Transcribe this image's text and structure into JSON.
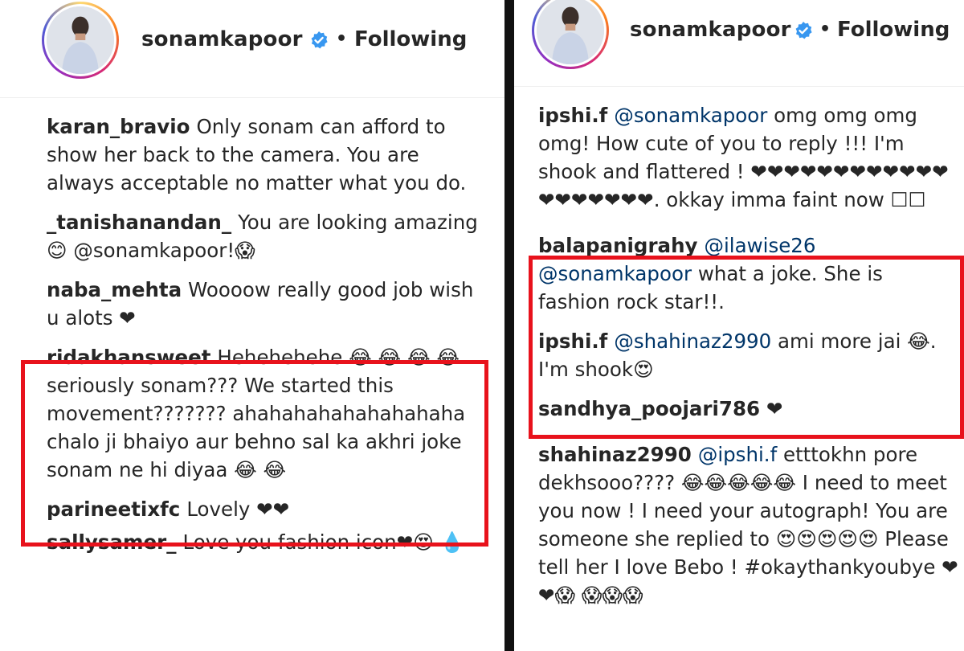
{
  "left": {
    "header": {
      "username": "sonamkapoor",
      "separator": "•",
      "follow_status": "Following"
    },
    "comments": [
      {
        "user": "karan_bravio",
        "mention": "",
        "text": "Only sonam can afford to show her back to the camera. You are always acceptable no matter what you do."
      },
      {
        "user": "_tanishanandan_",
        "mention": "",
        "text": "You are looking amazing😊 @sonamkapoor!😱"
      },
      {
        "user": "naba_mehta",
        "mention": "",
        "text": "Woooow really good job wish u alots ❤"
      },
      {
        "user": "ridakhansweet",
        "mention": "",
        "text": "Hehehehehe 😂 😂 😂 😂 seriously sonam??? We started this movement??????? ahahahahahahahahaha chalo ji bhaiyo aur behno sal ka akhri joke sonam ne hi diyaa 😂 😂"
      },
      {
        "user": "parineetixfc",
        "mention": "",
        "text": "Lovely ❤❤"
      },
      {
        "user": "sallysamer_",
        "mention": "",
        "text": "Love you fashion icon❤😍 💧"
      }
    ]
  },
  "right": {
    "header": {
      "username": "sonamkapoor",
      "separator": "•",
      "follow_status": "Following"
    },
    "comments": [
      {
        "user": "ipshi.f",
        "mention": "@sonamkapoor",
        "text": "omg omg omg omg! How cute of you to reply !!! I'm shook and flattered ! ❤❤❤❤❤❤❤❤❤❤❤❤❤❤❤❤❤❤❤. okkay imma faint now ☐☐"
      },
      {
        "user": "balapanigrahy",
        "mention": "@ilawise26 @sonamkapoor",
        "text": "what a joke. She is fashion rock star!!."
      },
      {
        "user": "ipshi.f",
        "mention": "@shahinaz2990",
        "text": "ami more jai 😂. I'm shook😍"
      },
      {
        "user": "sandhya_poojari786",
        "mention": "",
        "text": "❤"
      },
      {
        "user": "shahinaz2990",
        "mention": "@ipshi.f",
        "text": "etttokhn pore dekhsooo???? 😂😂😂😂😂 I need to meet you now ! I need your autograph! You are someone she replied to 😍😍😍😍😍 Please tell her I love Bebo ! #okaythankyoubye ❤❤😱 😱😱😱"
      }
    ]
  },
  "colors": {
    "highlight_box": "#e8121c",
    "verified_badge": "#3897f0",
    "mention": "#003569",
    "divider": "#111111"
  },
  "icons": {
    "verified": "verified-badge-icon",
    "avatar": "profile-avatar"
  }
}
